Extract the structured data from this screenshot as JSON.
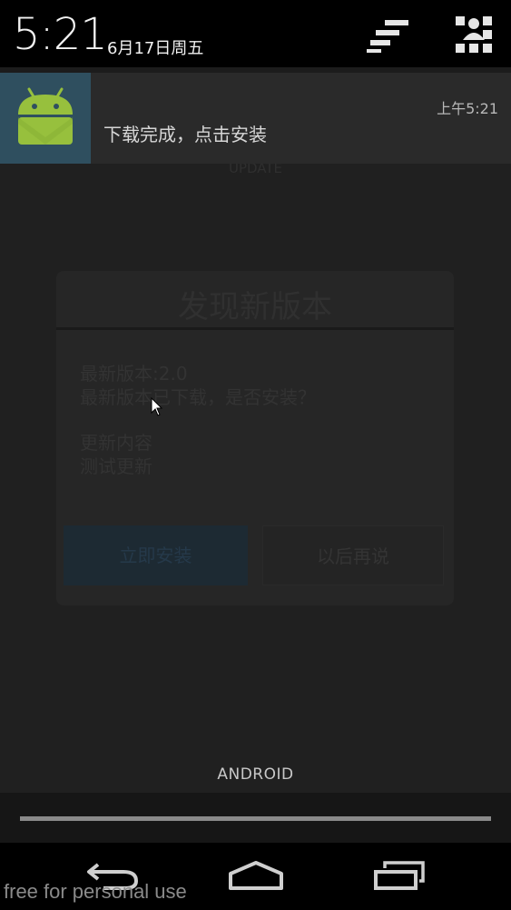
{
  "status": {
    "clock": "5:21",
    "date": "6月17日周五"
  },
  "notification": {
    "icon": "android-robot-icon",
    "text": "下载完成，点击安装",
    "time": "上午5:21"
  },
  "background_app": {
    "topbar_text": "UPDATE",
    "dialog": {
      "title": "发现新版本",
      "line1": "最新版本:2.0",
      "line2": "最新版本已下载，是否安装？",
      "line3": "更新内容",
      "line4": "测试更新",
      "install_button": "立即安装",
      "later_button": "以后再说"
    }
  },
  "carrier": "ANDROID",
  "navbar": {
    "back_icon": "back-icon",
    "home_icon": "home-icon",
    "recents_icon": "recents-icon"
  },
  "watermark": "free for personal use",
  "colors": {
    "notification_icon_bg": "#2f4f5f",
    "android_green": "#97c03d"
  }
}
